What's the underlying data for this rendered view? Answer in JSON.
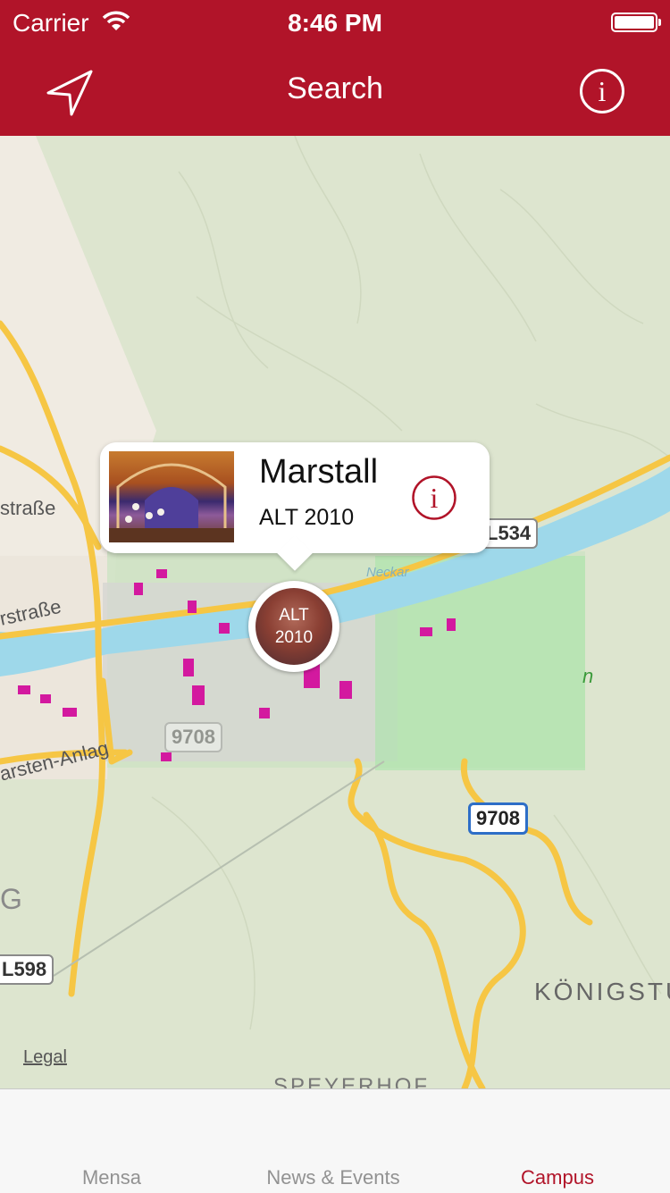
{
  "status_bar": {
    "carrier": "Carrier",
    "time": "8:46 PM"
  },
  "nav": {
    "title": "Search",
    "left_icon": "location-arrow-icon",
    "right_icon": "info-icon"
  },
  "colors": {
    "brand": "#b11429",
    "inactive_tab": "#929292"
  },
  "map": {
    "road_shields": {
      "l534": "L534",
      "r9708a": "9708",
      "r9708b": "9708",
      "l598": "L598"
    },
    "labels": {
      "strasse_top": "straße",
      "strasse_mid": "rstraße",
      "anlage": "arsten-Anlag",
      "neckar": "Neckar",
      "garten": "n",
      "g_left": "G",
      "koenigstuhl": "KÖNIGSTU",
      "speyerer": "SPEYERHOF"
    },
    "legal": "Legal",
    "callout": {
      "title": "Marstall",
      "subtitle": "ALT 2010",
      "info_icon": "info-icon"
    },
    "pin": {
      "line1": "ALT",
      "line2": "2010"
    }
  },
  "tabbar": {
    "tabs": [
      {
        "label": "Mensa"
      },
      {
        "label": "News & Events"
      },
      {
        "label": "Campus"
      }
    ],
    "active": "Campus"
  }
}
